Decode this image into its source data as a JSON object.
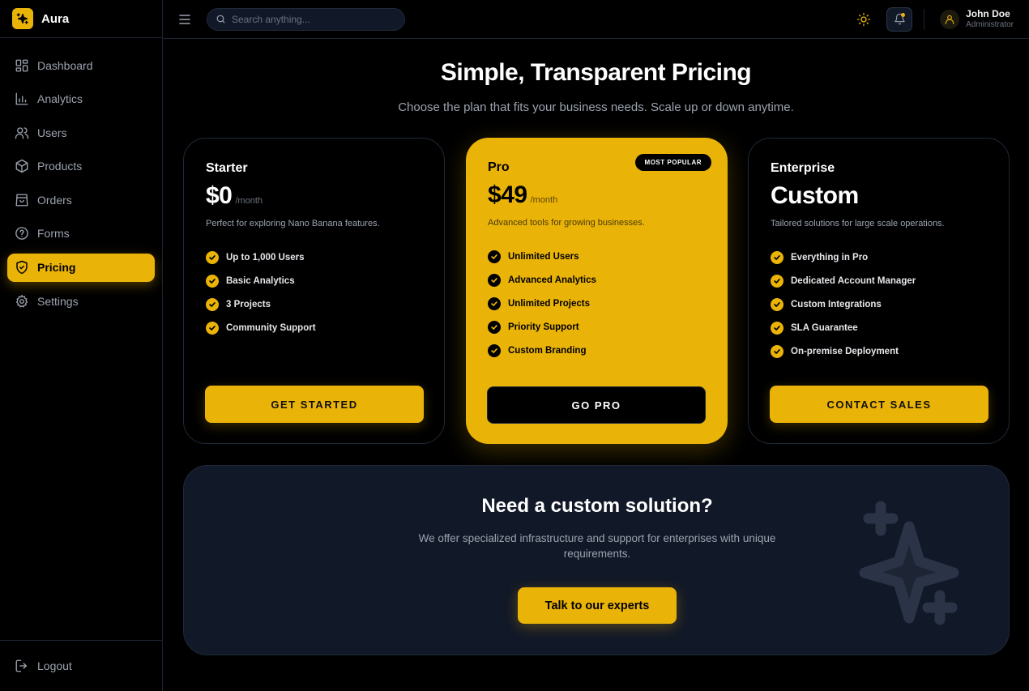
{
  "brand": {
    "name": "Aura"
  },
  "sidebar": {
    "items": [
      {
        "label": "Dashboard",
        "icon": "grid-icon",
        "active": false
      },
      {
        "label": "Analytics",
        "icon": "bar-chart-icon",
        "active": false
      },
      {
        "label": "Users",
        "icon": "users-icon",
        "active": false
      },
      {
        "label": "Products",
        "icon": "box-icon",
        "active": false
      },
      {
        "label": "Orders",
        "icon": "shopping-bag-icon",
        "active": false
      },
      {
        "label": "Forms",
        "icon": "help-circle-icon",
        "active": false
      },
      {
        "label": "Pricing",
        "icon": "shield-check-icon",
        "active": true
      },
      {
        "label": "Settings",
        "icon": "gear-icon",
        "active": false
      }
    ],
    "logout_label": "Logout"
  },
  "header": {
    "search_placeholder": "Search anything...",
    "user": {
      "name": "John Doe",
      "role": "Administrator"
    }
  },
  "page": {
    "title": "Simple, Transparent Pricing",
    "subtitle": "Choose the plan that fits your business needs. Scale up or down anytime."
  },
  "plans": [
    {
      "name": "Starter",
      "price": "$0",
      "period": "/month",
      "description": "Perfect for exploring Nano Banana features.",
      "features": [
        "Up to 1,000 Users",
        "Basic Analytics",
        "3 Projects",
        "Community Support"
      ],
      "button": "GET STARTED"
    },
    {
      "name": "Pro",
      "price": "$49",
      "period": "/month",
      "badge": "MOST POPULAR",
      "description": "Advanced tools for growing businesses.",
      "features": [
        "Unlimited Users",
        "Advanced Analytics",
        "Unlimited Projects",
        "Priority Support",
        "Custom Branding"
      ],
      "button": "GO PRO"
    },
    {
      "name": "Enterprise",
      "price": "Custom",
      "description": "Tailored solutions for large scale operations.",
      "features": [
        "Everything in Pro",
        "Dedicated Account Manager",
        "Custom Integrations",
        "SLA Guarantee",
        "On-premise Deployment"
      ],
      "button": "CONTACT SALES"
    }
  ],
  "cta": {
    "title": "Need a custom solution?",
    "text": "We offer specialized infrastructure and support for enterprises with unique requirements.",
    "button": "Talk to our experts"
  },
  "colors": {
    "accent": "#eab308",
    "background": "#000000",
    "panel": "#111827",
    "muted": "#9ca3af"
  }
}
